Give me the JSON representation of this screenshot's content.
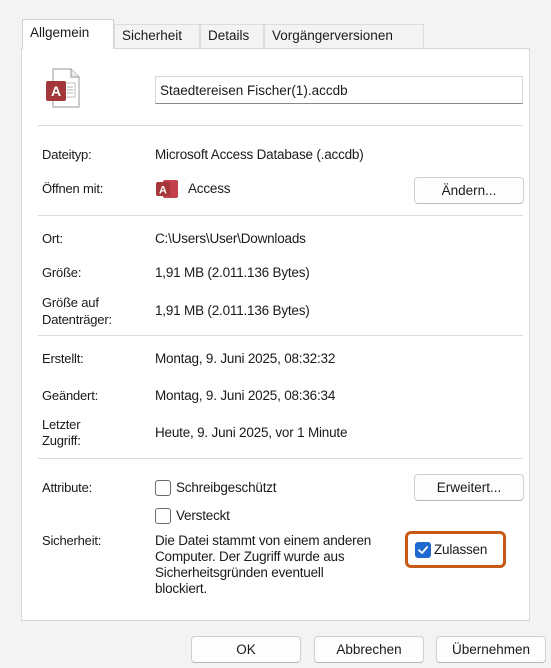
{
  "tabs": [
    {
      "label": "Allgemein",
      "active": true
    },
    {
      "label": "Sicherheit",
      "active": false
    },
    {
      "label": "Details",
      "active": false
    },
    {
      "label": "Vorgängerversionen",
      "active": false
    }
  ],
  "file": {
    "name": "Staedtereisen Fischer(1).accdb",
    "icon": "access-file-icon"
  },
  "dateityp": {
    "label": "Dateityp:",
    "value": "Microsoft Access Database (.accdb)"
  },
  "oeffnen_mit": {
    "label": "Öffnen mit:",
    "app": "Access",
    "app_icon": "access-app-icon",
    "change_button": "Ändern..."
  },
  "ort": {
    "label": "Ort:",
    "value": "C:\\Users\\User\\Downloads"
  },
  "groesse": {
    "label": "Größe:",
    "value": "1,91 MB (2.011.136 Bytes)"
  },
  "groesse_auf_datentraeger": {
    "label_line1": "Größe auf",
    "label_line2": "Datenträger:",
    "value": "1,91 MB (2.011.136 Bytes)"
  },
  "erstellt": {
    "label": "Erstellt:",
    "value": "Montag, 9. Juni 2025, 08:32:32"
  },
  "geaendert": {
    "label": "Geändert:",
    "value": "Montag, 9. Juni 2025, 08:36:34"
  },
  "letzter_zugriff": {
    "label_line1": "Letzter",
    "label_line2": "Zugriff:",
    "value": "Heute, 9. Juni 2025, vor 1 Minute"
  },
  "attribute": {
    "label": "Attribute:",
    "readonly_label": "Schreibgeschützt",
    "readonly_checked": false,
    "hidden_label": "Versteckt",
    "hidden_checked": false,
    "advanced_button": "Erweitert..."
  },
  "sicherheit": {
    "label": "Sicherheit:",
    "text_lines": [
      "Die Datei stammt von einem anderen",
      "Computer. Der Zugriff wurde aus",
      "Sicherheitsgründen eventuell",
      "blockiert."
    ],
    "allow_label": "Zulassen",
    "allow_checked": true
  },
  "footer": {
    "ok": "OK",
    "cancel": "Abbrechen",
    "apply": "Übernehmen"
  },
  "colors": {
    "accent": "#1f6ad0",
    "highlight": "#c65a16",
    "access_red": "#a4373a"
  }
}
